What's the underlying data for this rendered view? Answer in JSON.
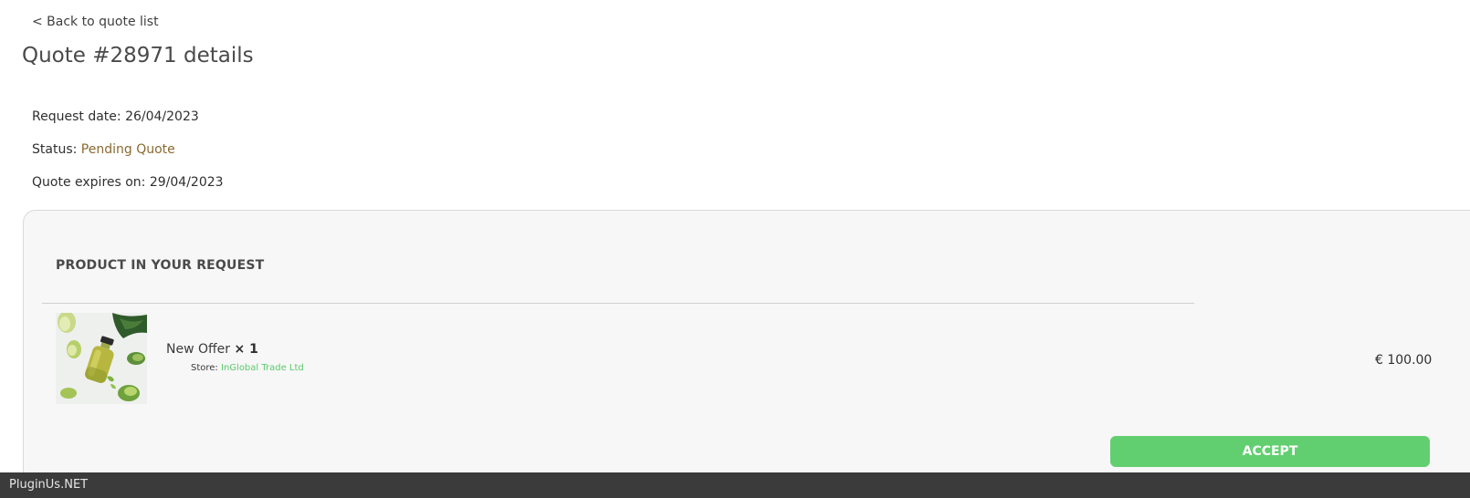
{
  "nav": {
    "back_label": "< Back to quote list"
  },
  "quote": {
    "title": "Quote #28971 details",
    "request_date_label": "Request date:",
    "request_date": "26/04/2023",
    "status_label": "Status:",
    "status": "Pending Quote",
    "expires_label": "Quote expires on:",
    "expires": "29/04/2023"
  },
  "products": {
    "heading": "PRODUCT IN YOUR REQUEST",
    "items": [
      {
        "image": "juice-bottle-thumbnail",
        "name": "New Offer",
        "qty": "× 1",
        "store_label": "Store:",
        "store_name": "InGlobal Trade Ltd",
        "price": "€ 100.00"
      }
    ],
    "accept_label": "ACCEPT"
  },
  "footer": {
    "brand": "PluginUs.NET"
  },
  "colors": {
    "accent_green": "#61cf70",
    "store_link": "#5cc96c",
    "status_pending": "#8a6a2f",
    "footer_bg": "#3b3b3b",
    "panel_bg": "#f7f7f7"
  }
}
